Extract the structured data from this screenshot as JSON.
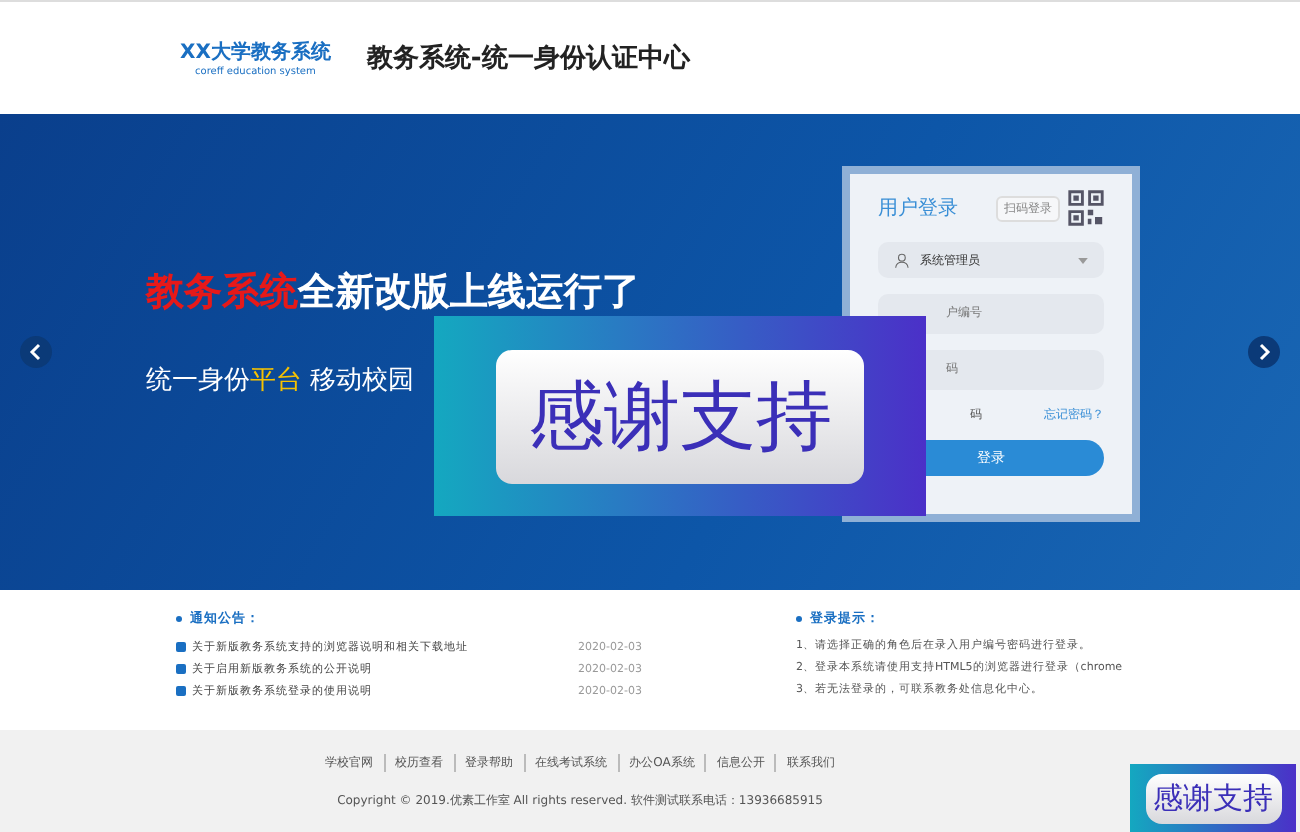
{
  "header": {
    "logo_title": "XX大学教务系统",
    "logo_subtitle": "coreff education system",
    "page_title": "教务系统-统一身份认证中心"
  },
  "banner": {
    "headline": [
      {
        "text": "教务系统",
        "highlight": true
      },
      {
        "text": "全新改版上线运行了",
        "highlight": false
      }
    ],
    "subline": [
      {
        "text": "统一身份",
        "highlight": false
      },
      {
        "text": "平台",
        "highlight": true
      },
      {
        "text": " 移动校园",
        "highlight": false
      }
    ]
  },
  "login": {
    "title": "用户登录",
    "scan_button": "扫码登录",
    "role": "系统管理员",
    "user_placeholder": "户编号",
    "password_placeholder": "码",
    "remember_label": "码",
    "forgot": "忘记密码？",
    "submit": "登录"
  },
  "notices": {
    "title": "通知公告：",
    "items": [
      {
        "text": "关于新版教务系统支持的浏览器说明和相关下载地址",
        "date": "2020-02-03"
      },
      {
        "text": "关于启用新版教务系统的公开说明",
        "date": "2020-02-03"
      },
      {
        "text": "关于新版教务系统登录的使用说明",
        "date": "2020-02-03"
      }
    ]
  },
  "tips": {
    "title": "登录提示：",
    "items": [
      "1、请选择正确的角色后在录入用户编号密码进行登录。",
      "2、登录本系统请使用支持HTML5的浏览器进行登录（chrome",
      "3、若无法登录的，可联系教务处信息化中心。"
    ]
  },
  "footer": {
    "links": [
      "学校官网",
      "校历查看",
      "登录帮助",
      "在线考试系统",
      "办公OA系统",
      "信息公开",
      "联系我们"
    ],
    "copyright": "Copyright © 2019.优素工作室 All rights reserved. 软件测试联系电话：13936685915"
  },
  "ad_large": {
    "text": "感谢支持"
  },
  "ad_small": {
    "text": "感谢支持"
  }
}
